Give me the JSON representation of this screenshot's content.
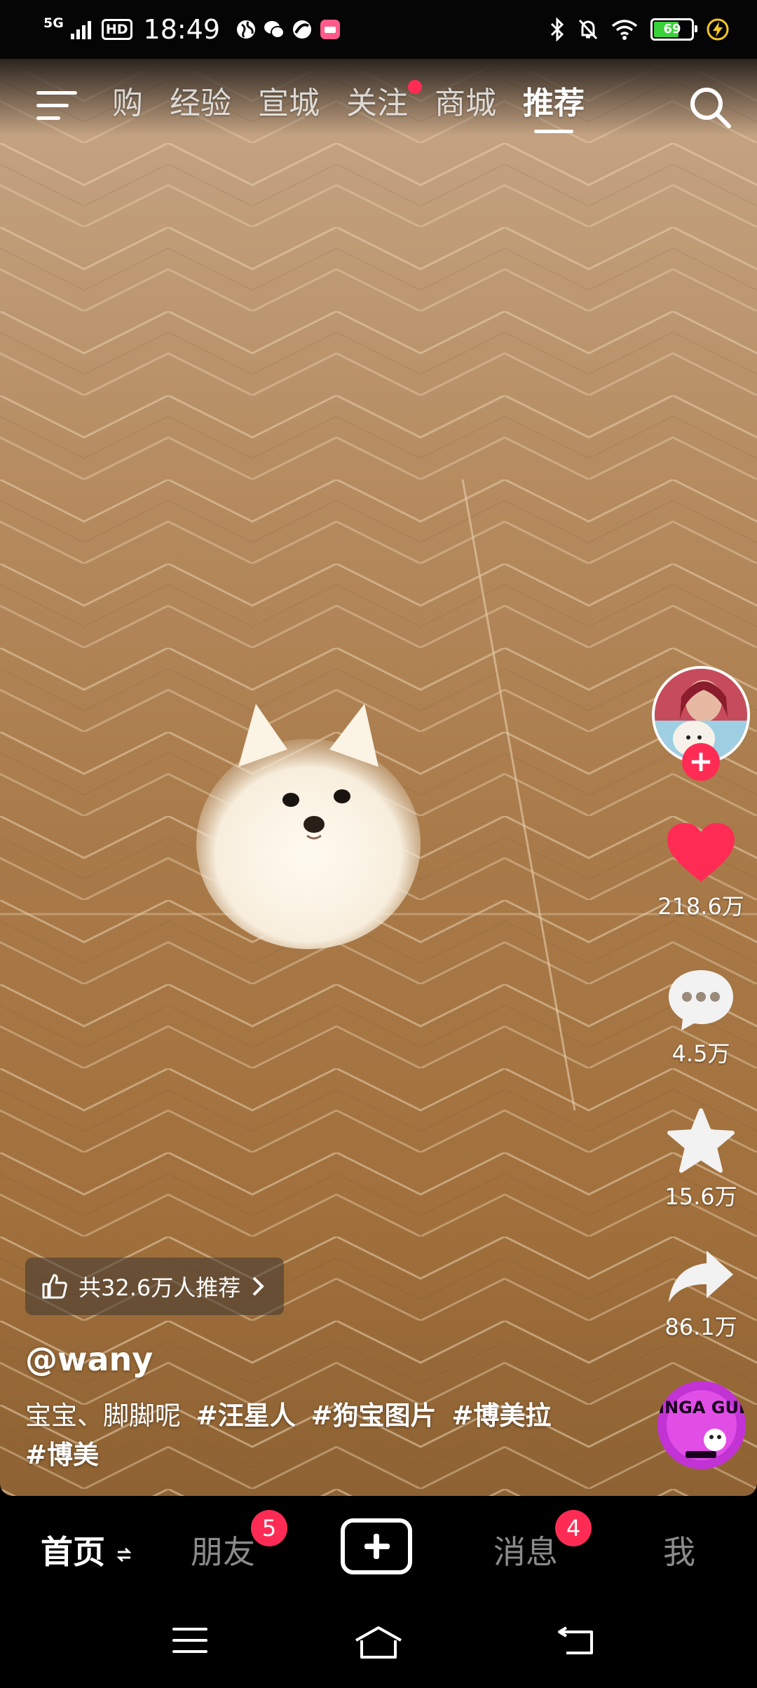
{
  "status_bar": {
    "network": "5G",
    "hd": "HD",
    "time": "18:49",
    "battery": "69",
    "battery_level": 0.69
  },
  "top_nav": {
    "tabs": [
      "购",
      "经验",
      "宣城",
      "关注",
      "商城",
      "推荐"
    ],
    "active_tab": "推荐"
  },
  "actions": {
    "likes": "218.6万",
    "comments": "4.5万",
    "favorites": "15.6万",
    "shares": "86.1万"
  },
  "video": {
    "recommend_text": "共32.6万人推荐",
    "author": "@wany",
    "caption_text": "宝宝、脚脚呢",
    "hashtags": [
      "#汪星人",
      "#狗宝图片",
      "#博美拉",
      "#博美"
    ]
  },
  "music_disc": {
    "art_text": "LINGA GULI"
  },
  "bottom_tabs": {
    "home": "首页",
    "friends": "朋友",
    "friends_badge": "5",
    "messages": "消息",
    "messages_badge": "4",
    "me": "我"
  },
  "colors": {
    "accent": "#fe2c55",
    "floor": "#a97a49"
  }
}
